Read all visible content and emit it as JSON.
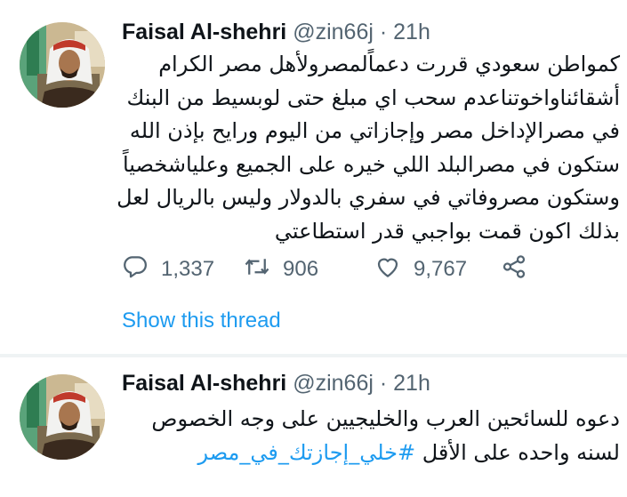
{
  "tweets": [
    {
      "author_name": "Faisal Al-shehri",
      "handle": "@zin66j",
      "separator": "·",
      "time": "21h",
      "lines": [
        "كمواطن سعودي قررت دعماًلمصرولأهل مصر الكرام",
        "أشقائناواخوتناعدم سحب اي مبلغ حتى لوبسيط من البنك",
        "في مصرالإداخل مصر وإجازاتي من اليوم ورايح بإذن الله",
        "ستكون في مصرالبلد اللي خيره على الجميع وعلياشخصياً",
        "وستكون مصروفاتي في سفري بالدولار وليس بالريال لعل",
        "بذلك اكون قمت بواجبي قدر استطاعتي"
      ],
      "actions": {
        "reply_count": "1,337",
        "retweet_count": "906",
        "like_count": "9,767"
      },
      "show_thread_label": "Show this thread"
    },
    {
      "author_name": "Faisal Al-shehri",
      "handle": "@zin66j",
      "separator": "·",
      "time": "21h",
      "lines": [
        "دعوه للسائحين العرب والخليجيين على وجه الخصوص",
        "لسنه واحده على الأقل"
      ],
      "hashtag": "#خلي_إجازتك_في_مصر"
    }
  ],
  "icons": [
    "reply-icon",
    "retweet-icon",
    "like-icon",
    "share-icon"
  ],
  "colors": {
    "link": "#1d9bf0",
    "secondary": "#536471",
    "text": "#0f1419"
  }
}
